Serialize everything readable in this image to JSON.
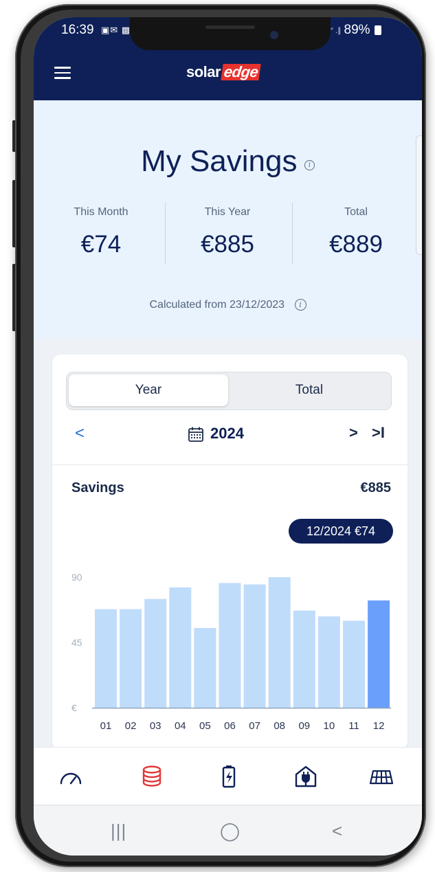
{
  "status_bar": {
    "time": "16:39",
    "left_icons": "▣✉ ▩",
    "signal_text": "″ .∥",
    "battery": "89%"
  },
  "header": {
    "logo_solar": "solar",
    "logo_edge": "edge"
  },
  "savings": {
    "title": "My Savings",
    "stats": [
      {
        "label": "This Month",
        "value": "€74"
      },
      {
        "label": "This Year",
        "value": "€885"
      },
      {
        "label": "Total",
        "value": "€889"
      }
    ],
    "calculated_from": "Calculated from 23/12/2023"
  },
  "period_toggle": {
    "options": [
      "Year",
      "Total"
    ],
    "selected": "Year"
  },
  "period_nav": {
    "prev": "<",
    "year": "2024",
    "next": ">",
    "last": ">I"
  },
  "chart_card": {
    "title": "Savings",
    "total": "€885",
    "tooltip": "12/2024 €74"
  },
  "chart_data": {
    "type": "bar",
    "categories": [
      "01",
      "02",
      "03",
      "04",
      "05",
      "06",
      "07",
      "08",
      "09",
      "10",
      "11",
      "12"
    ],
    "values": [
      68,
      68,
      75,
      83,
      55,
      86,
      85,
      90,
      67,
      63,
      60,
      74
    ],
    "ylim": [
      0,
      90
    ],
    "y_ticks": [
      "€",
      "45",
      "90"
    ],
    "y_tick_values": [
      0,
      45,
      90
    ],
    "highlight_index": 11,
    "bar_color": "#bfdcfb",
    "highlight_color": "#6aa0fb",
    "ylabel": "",
    "xlabel": ""
  },
  "bottom_nav": {
    "tabs": [
      {
        "icon": "dashboard-gauge-icon",
        "active": false
      },
      {
        "icon": "savings-coins-icon",
        "active": true
      },
      {
        "icon": "battery-icon",
        "active": false
      },
      {
        "icon": "smart-plug-home-icon",
        "active": false
      },
      {
        "icon": "solar-panel-icon",
        "active": false
      }
    ],
    "active_color": "#e0393a",
    "inactive_color": "#0e2057"
  },
  "system_nav": {
    "recents": "|||",
    "home": "◯",
    "back": "<"
  }
}
